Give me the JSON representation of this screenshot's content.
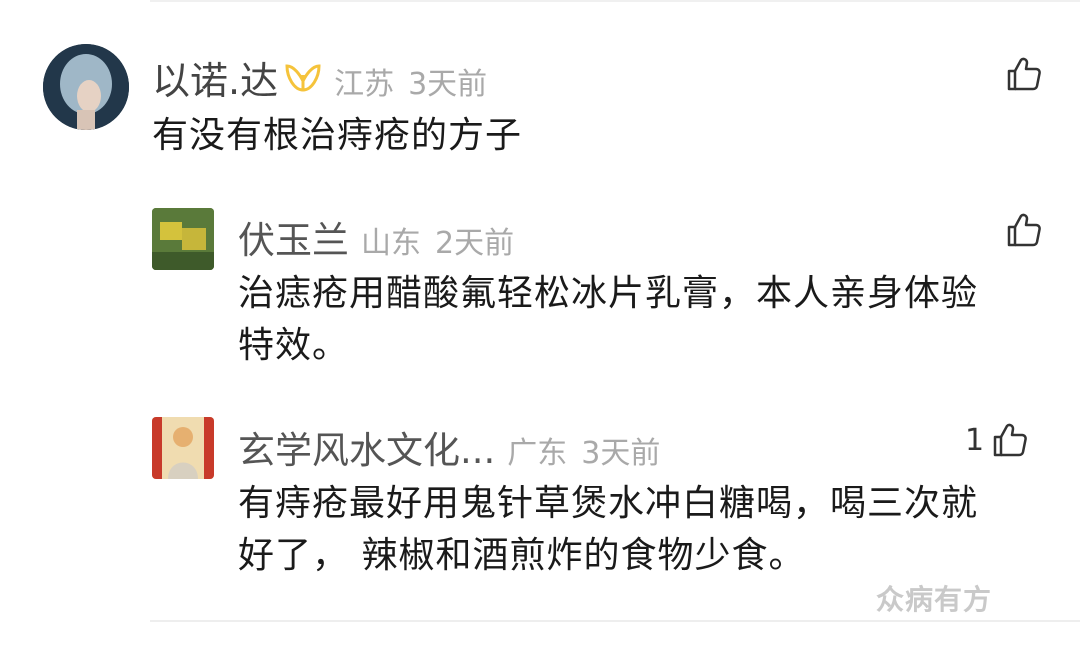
{
  "comments": [
    {
      "user": "以诺.达",
      "location": "江苏",
      "time": "3天前",
      "text": "有没有根治痔疮的方子",
      "likes": ""
    }
  ],
  "replies": [
    {
      "user": "伏玉兰",
      "location": "山东",
      "time": "2天前",
      "text_line1": "治痣疮用醋酸氟轻松冰片乳膏，本人亲身体验",
      "text_line2": "特效。",
      "likes": ""
    },
    {
      "user": "玄学风水文化...",
      "location": "广东",
      "time": "3天前",
      "text_line1": "有痔疮最好用鬼针草煲水冲白糖喝，喝三次就",
      "text_line2": "好了， 辣椒和酒煎炸的食物少食。",
      "likes": "1"
    }
  ],
  "watermark": "众病有方",
  "colors": {
    "name": "#555555",
    "meta": "#a9a9a9",
    "text": "#1a1a1a",
    "vip_badge": "#f5c33b",
    "watermark": "#c9c9c9"
  },
  "icons": {
    "like": "thumbs-up-icon",
    "vip": "vip-badge-icon"
  }
}
